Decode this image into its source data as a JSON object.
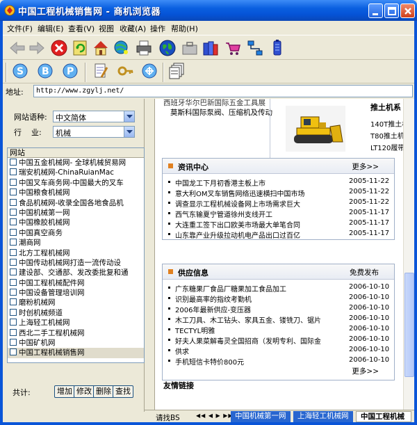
{
  "window": {
    "title": "中国工程机械销售网 - 商机浏览器"
  },
  "menu": [
    "文件(F)",
    "编辑(E)",
    "查看(V)",
    "视图",
    "收藏(A)",
    "操作",
    "帮助(H)"
  ],
  "toolbar": {
    "row1_icons": [
      "back-arrow-icon",
      "forward-arrow-icon",
      "stop-icon",
      "refresh-icon",
      "home-icon",
      "globe-search-icon",
      "printer-icon",
      "world-icon",
      "briefcase-icon",
      "books-icon",
      "cart-icon",
      "network-icon",
      "battery-icon"
    ],
    "row2_icons": [
      "search-s-icon",
      "search-b-icon",
      "search-p-icon",
      "edit-document-icon",
      "key-icon",
      "network-globe-icon",
      "stack-document-icon"
    ]
  },
  "address": {
    "label": "地址:",
    "value": "http://www.zgylj.net/"
  },
  "left_panel": {
    "language_label": "网站语种:",
    "language_value": "中文简体",
    "industry_label": "行    业:",
    "industry_value": "机械",
    "list_header": "网站",
    "sites": [
      "中国五金机械网- 全球机械贸易网",
      "瑞安机械网-ChinaRuianMac",
      "中国叉车商务网-中国最大的叉车",
      "中国粮食机械网",
      "食品机械网-收录全国各地食品机",
      "中国机械第一网",
      "中国橡胶机械网",
      "中国真空商务",
      "潮商网",
      "北方工程机械网",
      "中国传动机械网打造一流传动设",
      "建设部、交通部、发改委批复和通",
      "中国工程机械配件网",
      "中国设备管理培训网",
      "磨粉机械网",
      "时创机械频道",
      "上海轻工机械网",
      "西北二手工程机械网",
      "中国矿机网",
      "中国工程机械销售网"
    ],
    "total_label": "共计:",
    "buttons": [
      "增加",
      "修改",
      "删除",
      "查找"
    ]
  },
  "content": {
    "top_text1": "西班牙华尔巴新国际五金工具展",
    "top_text2": "莫斯科国际泵阀、压缩机及传动",
    "product_title": "推土机系",
    "products": [
      "140T推土机",
      "T80推土机",
      "LT120履带"
    ],
    "news_title": "资讯中心",
    "news_more": "更多>>",
    "news": [
      {
        "title": "中国龙工下月初香港主板上市",
        "date": "2005-11-22"
      },
      {
        "title": "意大利OM叉车销售网络迅速横扫中国市场",
        "date": "2005-11-22"
      },
      {
        "title": "调查显示工程机械设备网上市场需求巨大",
        "date": "2005-11-22"
      },
      {
        "title": "西气东输夏宁管道徐州支线开工",
        "date": "2005-11-17"
      },
      {
        "title": "大连重工签下出口欧美市场最大单笔合同",
        "date": "2005-11-17"
      },
      {
        "title": "山东靠产业升级拉动机电产品出口过百亿",
        "date": "2005-11-17"
      }
    ],
    "supply_title": "供应信息",
    "supply_more": "免费发布",
    "supply": [
      {
        "title": "广东糖果厂食品厂糖果加工食品加工",
        "date": "2006-10-10"
      },
      {
        "title": "识别最高率的指纹考勤机",
        "date": "2006-10-10"
      },
      {
        "title": "2006年最新供应-变压器",
        "date": "2006-10-10"
      },
      {
        "title": "木工刀具、木工钻头、家具五金、镂铣刀、锯片",
        "date": "2006-10-10"
      },
      {
        "title": "TECTYL明雅",
        "date": "2006-10-10"
      },
      {
        "title": "好夫人果菜解毒灵全国招商（发明专利、国际金",
        "date": "2006-10-10"
      },
      {
        "title": "供求",
        "date": "2006-10-10"
      },
      {
        "title": "手机短信卡特价800元",
        "date": "2006-10-10"
      }
    ],
    "supply_more2": "更多>>",
    "friends_title": "友情链接"
  },
  "status": {
    "left": "请找BS",
    "tabs": [
      "中国机械第一网",
      "上海轻工机械网",
      "中国工程机械"
    ]
  }
}
